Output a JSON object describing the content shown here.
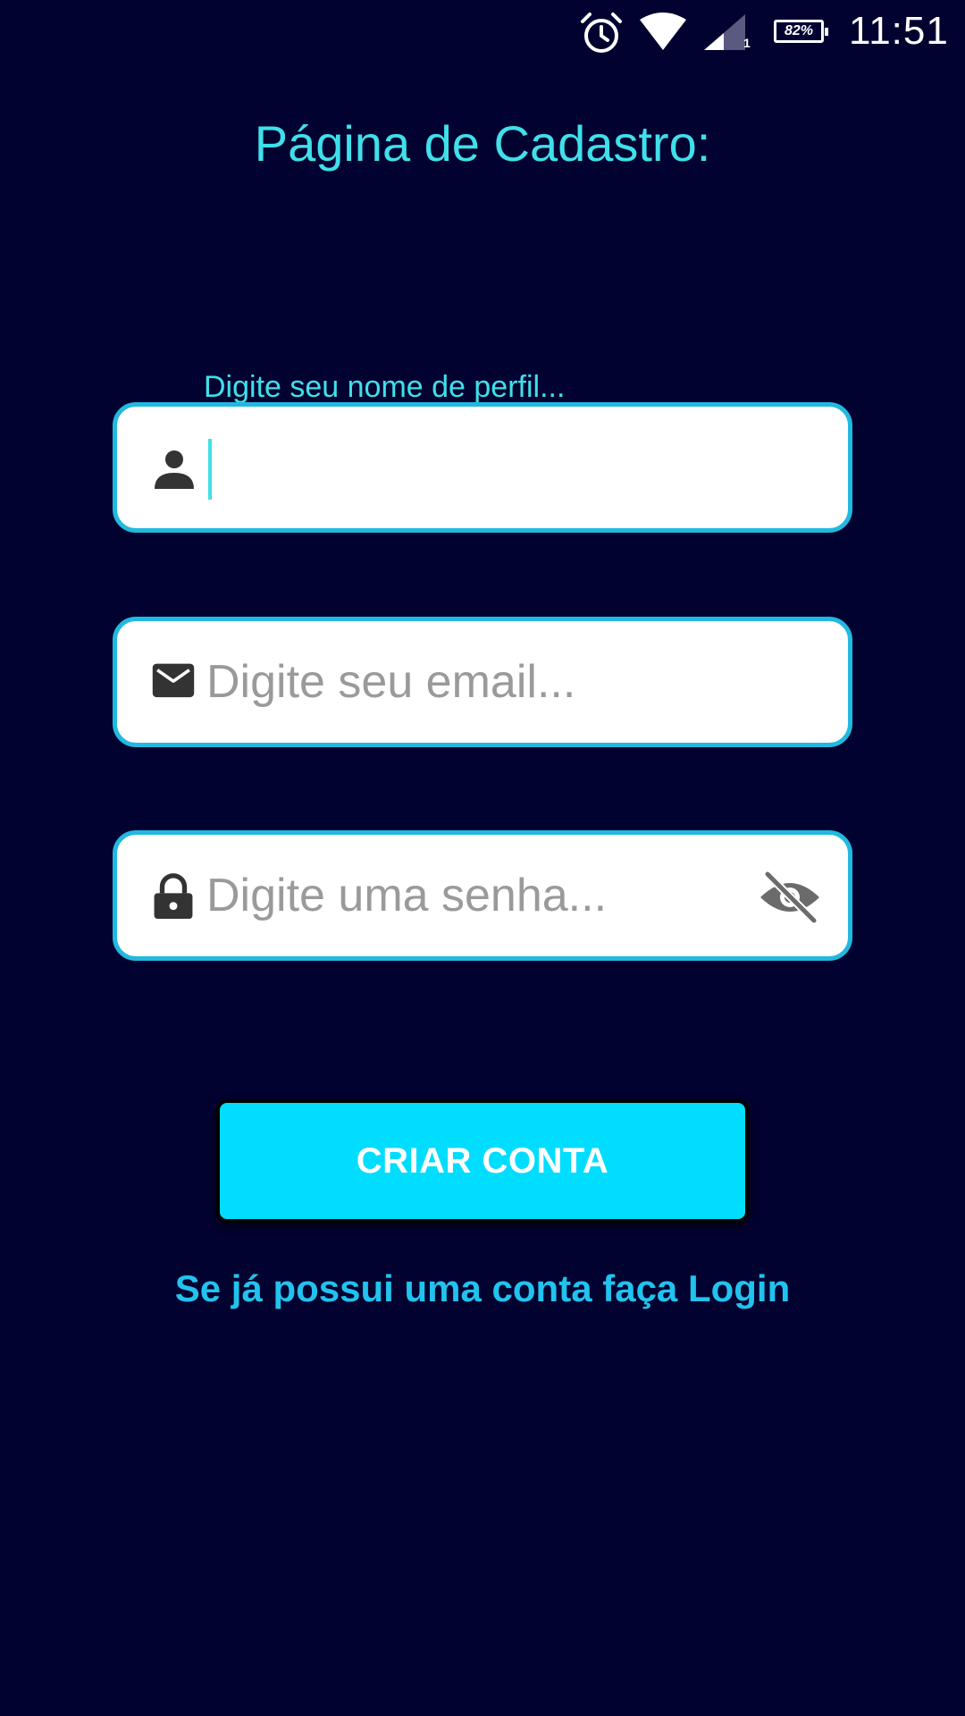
{
  "status_bar": {
    "time": "11:51",
    "battery_text": "82%",
    "signal_sub": "1",
    "icons": [
      "alarm-icon",
      "wifi-icon",
      "signal-icon",
      "battery-icon"
    ]
  },
  "page": {
    "title": "Página de Cadastro:"
  },
  "form": {
    "name_field": {
      "floating_label": "Digite seu nome de perfil...",
      "value": "",
      "icon": "person-icon"
    },
    "email_field": {
      "placeholder": "Digite seu email...",
      "value": "",
      "icon": "mail-icon"
    },
    "password_field": {
      "placeholder": "Digite uma senha...",
      "value": "",
      "icon": "lock-icon",
      "toggle_icon": "eye-off-icon"
    },
    "submit_label": "CRIAR CONTA",
    "login_link": "Se já possui uma conta faça Login"
  },
  "colors": {
    "background": "#020230",
    "accent": "#3fe0ea",
    "field_border": "#21b9e0",
    "button": "#00ddff",
    "link": "#21c3ee"
  }
}
